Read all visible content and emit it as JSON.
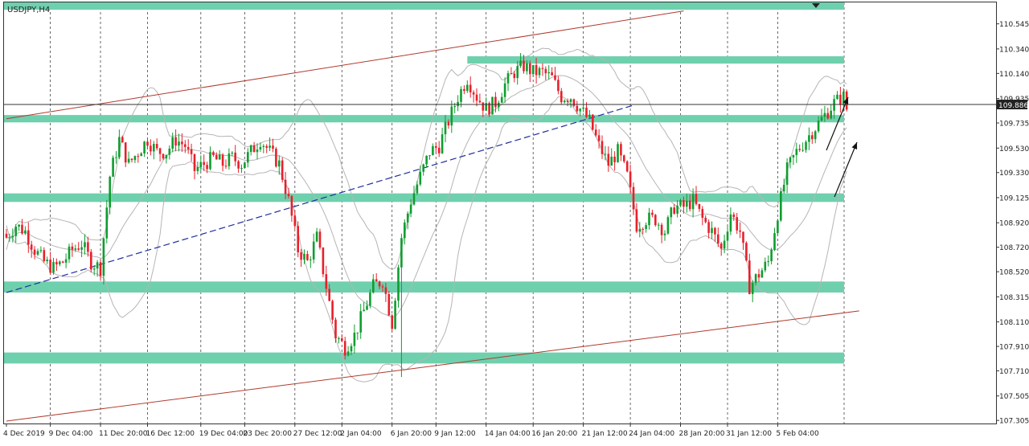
{
  "chart_data": {
    "type": "candlestick",
    "title": "USDJPY,H4",
    "symbol": "USDJPY",
    "timeframe": "H4",
    "ylim": [
      107.28,
      110.72
    ],
    "y_ticks": [
      110.545,
      110.34,
      110.14,
      109.935,
      109.735,
      109.53,
      109.33,
      109.125,
      108.92,
      108.72,
      108.52,
      108.315,
      108.11,
      107.91,
      107.71,
      107.505,
      107.305
    ],
    "current_price": 109.886,
    "current_price_label": "109.886",
    "x_labels": [
      "4 Dec 2019",
      "9 Dec 04:00",
      "11 Dec 20:00",
      "16 Dec 12:00",
      "19 Dec 04:00",
      "23 Dec 20:00",
      "27 Dec 12:00",
      "2 Jan 04:00",
      "6 Jan 20:00",
      "9 Jan 12:00",
      "14 Jan 04:00",
      "16 Jan 20:00",
      "21 Jan 12:00",
      "24 Jan 04:00",
      "28 Jan 20:00",
      "31 Jan 12:00",
      "5 Feb 04:00"
    ],
    "close_path": [
      [
        0,
        108.8
      ],
      [
        3,
        108.9
      ],
      [
        6,
        108.85
      ],
      [
        9,
        108.7
      ],
      [
        12,
        108.6
      ],
      [
        15,
        108.55
      ],
      [
        18,
        108.6
      ],
      [
        21,
        108.7
      ],
      [
        24,
        108.75
      ],
      [
        27,
        108.6
      ],
      [
        30,
        108.55
      ],
      [
        33,
        109.3
      ],
      [
        36,
        109.6
      ],
      [
        39,
        109.4
      ],
      [
        42,
        109.5
      ],
      [
        45,
        109.6
      ],
      [
        48,
        109.5
      ],
      [
        51,
        109.5
      ],
      [
        54,
        109.6
      ],
      [
        57,
        109.55
      ],
      [
        60,
        109.35
      ],
      [
        63,
        109.4
      ],
      [
        66,
        109.45
      ],
      [
        69,
        109.4
      ],
      [
        72,
        109.45
      ],
      [
        75,
        109.4
      ],
      [
        78,
        109.5
      ],
      [
        81,
        109.6
      ],
      [
        84,
        109.5
      ],
      [
        87,
        109.4
      ],
      [
        90,
        109.1
      ],
      [
        93,
        108.7
      ],
      [
        96,
        108.6
      ],
      [
        99,
        108.8
      ],
      [
        102,
        108.4
      ],
      [
        105,
        108.0
      ],
      [
        108,
        107.9
      ],
      [
        111,
        108.0
      ],
      [
        114,
        108.2
      ],
      [
        117,
        108.4
      ],
      [
        120,
        108.45
      ],
      [
        123,
        108.1
      ],
      [
        126,
        108.8
      ],
      [
        129,
        109.1
      ],
      [
        132,
        109.3
      ],
      [
        135,
        109.5
      ],
      [
        138,
        109.55
      ],
      [
        141,
        109.75
      ],
      [
        144,
        109.95
      ],
      [
        147,
        110.1
      ],
      [
        150,
        109.95
      ],
      [
        153,
        109.85
      ],
      [
        156,
        109.9
      ],
      [
        159,
        110.05
      ],
      [
        162,
        110.15
      ],
      [
        165,
        110.2
      ],
      [
        168,
        110.15
      ],
      [
        171,
        110.15
      ],
      [
        174,
        110.1
      ],
      [
        177,
        109.95
      ],
      [
        180,
        109.95
      ],
      [
        183,
        109.85
      ],
      [
        186,
        109.75
      ],
      [
        189,
        109.55
      ],
      [
        192,
        109.4
      ],
      [
        195,
        109.5
      ],
      [
        198,
        109.3
      ],
      [
        201,
        108.9
      ],
      [
        204,
        108.95
      ],
      [
        207,
        108.95
      ],
      [
        210,
        108.85
      ],
      [
        213,
        109.05
      ],
      [
        216,
        109.05
      ],
      [
        219,
        109.1
      ],
      [
        222,
        108.95
      ],
      [
        225,
        108.85
      ],
      [
        228,
        108.7
      ],
      [
        231,
        109.0
      ],
      [
        234,
        108.85
      ],
      [
        237,
        108.4
      ],
      [
        240,
        108.5
      ],
      [
        243,
        108.6
      ],
      [
        246,
        109.0
      ],
      [
        249,
        109.35
      ],
      [
        252,
        109.5
      ],
      [
        255,
        109.6
      ],
      [
        258,
        109.7
      ],
      [
        261,
        109.8
      ],
      [
        264,
        109.9
      ],
      [
        267,
        109.95
      ],
      [
        268,
        109.85
      ]
    ],
    "zones": [
      {
        "type": "resistance",
        "low": 110.66,
        "high": 110.72
      },
      {
        "type": "resistance",
        "low": 110.22,
        "high": 110.28
      },
      {
        "type": "support_resistance",
        "low": 109.74,
        "high": 109.8
      },
      {
        "type": "support_resistance",
        "low": 109.09,
        "high": 109.16
      },
      {
        "type": "support",
        "low": 108.35,
        "high": 108.44
      },
      {
        "type": "support",
        "low": 107.77,
        "high": 107.86
      }
    ],
    "trendlines": [
      {
        "name": "channel-upper",
        "style": "solid",
        "color": "#b03a2e",
        "points": [
          [
            0,
            109.77
          ],
          [
            216,
            110.65
          ]
        ]
      },
      {
        "name": "channel-lower",
        "style": "solid",
        "color": "#b03a2e",
        "points": [
          [
            0,
            107.3
          ],
          [
            272,
            108.2
          ]
        ]
      },
      {
        "name": "ascending-trend",
        "style": "dashed",
        "color": "#1f2f9e",
        "points": [
          [
            0,
            108.35
          ],
          [
            200,
            109.88
          ]
        ]
      }
    ],
    "colors": {
      "bull": "#0f9d2f",
      "bear": "#e8202b",
      "zone": "#6fd0ae",
      "bands": "#b5b5b5",
      "grid": "#444444",
      "axis_text": "#222222"
    },
    "grid": "vertical dashed",
    "arrows": "up",
    "marker": "down-triangle",
    "bollinger_bands": true
  }
}
